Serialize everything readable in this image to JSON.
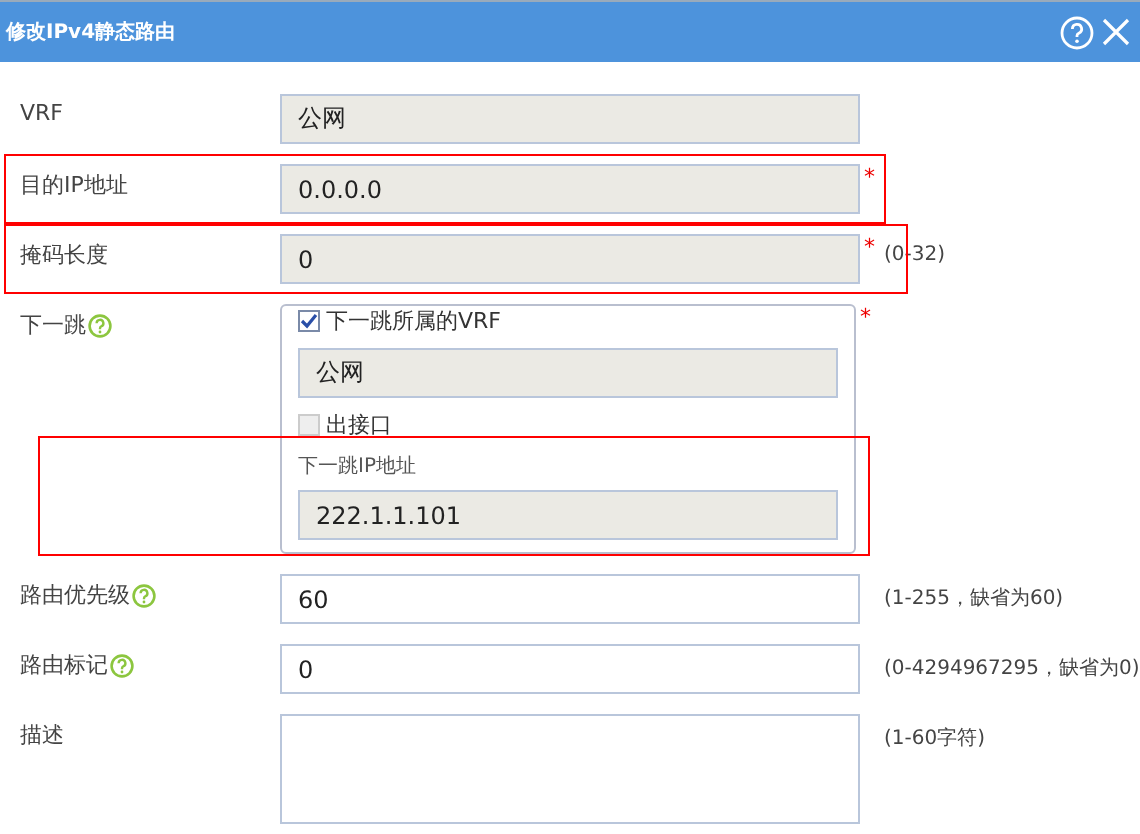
{
  "window": {
    "title": "修改IPv4静态路由",
    "buttons": [
      {
        "kind": "help"
      },
      {
        "kind": "close"
      }
    ]
  },
  "fields": [
    {
      "kind": "locked",
      "label": "VRF",
      "value": "公网",
      "annotated": false
    },
    {
      "kind": "locked",
      "label": "目的IP地址",
      "value": "0.0.0.0",
      "required_mark": "*",
      "annotated": true
    },
    {
      "kind": "locked",
      "label": "掩码长度",
      "value": "0",
      "required_mark": "*",
      "hint": "(0-32)",
      "annotated": true
    },
    {
      "kind": "group",
      "label": "下一跳",
      "help": true,
      "required_mark": "*",
      "items": [
        {
          "kind": "checkbox",
          "label": "下一跳所属的VRF",
          "checked": true,
          "disabled": false
        },
        {
          "kind": "locked",
          "value": "公网"
        },
        {
          "kind": "checkbox",
          "label": "出接口",
          "checked": false,
          "disabled": true
        },
        {
          "kind": "labeled-locked",
          "label": "下一跳IP地址",
          "value": "222.1.1.101",
          "annotated": true
        }
      ]
    },
    {
      "kind": "input",
      "label": "路由优先级",
      "help": true,
      "value": "60",
      "hint": "(1-255，缺省为60)",
      "annotated": false
    },
    {
      "kind": "input",
      "label": "路由标记",
      "help": true,
      "value": "0",
      "hint": "(0-4294967295，缺省为0)",
      "annotated": false
    },
    {
      "kind": "textarea",
      "label": "描述",
      "hint": "(1-60字符)",
      "annotated": false
    }
  ]
}
